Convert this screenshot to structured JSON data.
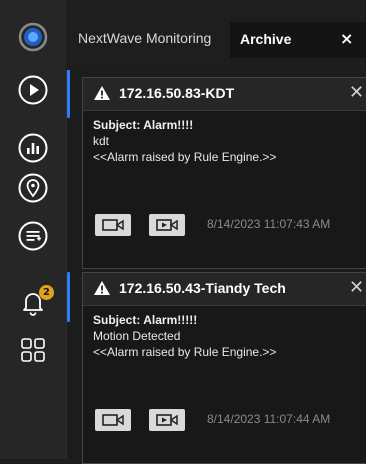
{
  "app": {
    "tab_left": "NextWave Monitoring",
    "tab_active": "Archive",
    "tab_close": "×"
  },
  "rail": {
    "items": [
      {
        "icon": "logo-icon"
      },
      {
        "icon": "play-icon"
      },
      {
        "icon": "chart-icon"
      },
      {
        "icon": "location-pin-icon"
      },
      {
        "icon": "list-icon"
      },
      {
        "icon": "bell-icon",
        "badge": "2"
      },
      {
        "icon": "grid-icon"
      }
    ]
  },
  "alarms": [
    {
      "title": "172.16.50.83-KDT",
      "close": "✕",
      "subject": "Subject: Alarm!!!!",
      "line1": "kdt",
      "line2": "<<Alarm raised by Rule Engine.>>",
      "timestamp": "8/14/2023 11:07:43 AM"
    },
    {
      "title": "172.16.50.43-Tiandy Tech",
      "close": "✕",
      "subject": "Subject: Alarm!!!!!",
      "line1": "Motion Detected",
      "line2": "<<Alarm raised by Rule Engine.>>",
      "timestamp": "8/14/2023 11:07:44 AM"
    }
  ],
  "colors": {
    "accent": "#2f7df6",
    "badge": "#e2a31c"
  }
}
